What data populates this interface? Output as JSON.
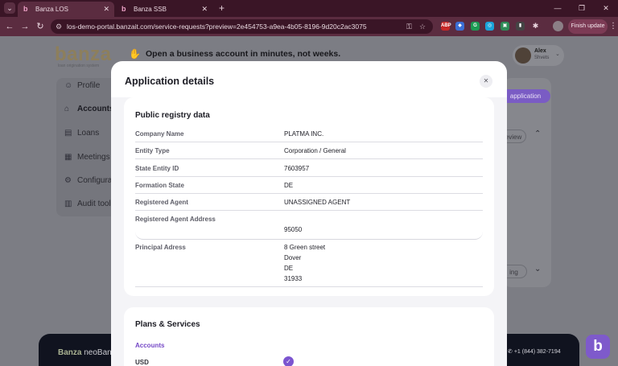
{
  "browser": {
    "tabs": [
      {
        "title": "Banza LOS",
        "active": true
      },
      {
        "title": "Banza SSB",
        "active": false
      }
    ],
    "url": "los-demo-portal.banzait.com/service-requests?preview=2e454753-a9ea-4b05-8196-9d20c2ac3075",
    "finish_update_label": "Finish update"
  },
  "app": {
    "logo": "banza",
    "logo_subtitle": "loan origination system",
    "tagline": "Open a business account in minutes, not weeks.",
    "user": {
      "name": "Alex",
      "role": "Shvets"
    },
    "sidebar": [
      {
        "label": "Profile",
        "icon": "user-icon"
      },
      {
        "label": "Accounts",
        "icon": "bank-icon",
        "active": true
      },
      {
        "label": "Loans",
        "icon": "document-icon"
      },
      {
        "label": "Meetings",
        "icon": "calendar-icon"
      },
      {
        "label": "Configurati",
        "icon": "settings-icon"
      },
      {
        "label": "Audit tools",
        "icon": "audit-icon"
      }
    ],
    "bg_application_button": "application",
    "bg_review_pill": "eview",
    "bg_pending_pill": "ing",
    "footer": {
      "brand": "Banza",
      "brand_suffix": "neoBank",
      "phone": "+1 (844) 382-7194"
    },
    "help_fab": "b"
  },
  "modal": {
    "title": "Application details",
    "close_icon": "close-icon",
    "public_registry": {
      "title": "Public registry data",
      "rows": [
        {
          "label": "Company Name",
          "value": "PLATMA INC."
        },
        {
          "label": "Entity Type",
          "value": "Corporation / General"
        },
        {
          "label": "State Entity ID",
          "value": "7603957"
        },
        {
          "label": "Formation State",
          "value": "DE"
        },
        {
          "label": "Registered Agent",
          "value": "UNASSIGNED AGENT"
        },
        {
          "label": "Registered Agent Address",
          "value": "95050"
        }
      ],
      "principal_address": {
        "label": "Principal Adress",
        "lines": [
          "8 Green street",
          "Dover",
          "DE",
          "31933"
        ]
      }
    },
    "plans": {
      "title": "Plans & Services",
      "subtitle": "Accounts",
      "item": "USD",
      "item_checked": true
    }
  },
  "colors": {
    "accent": "#7c55d0",
    "browser_frame": "#3a1526",
    "overlay": "#7c7d84"
  }
}
